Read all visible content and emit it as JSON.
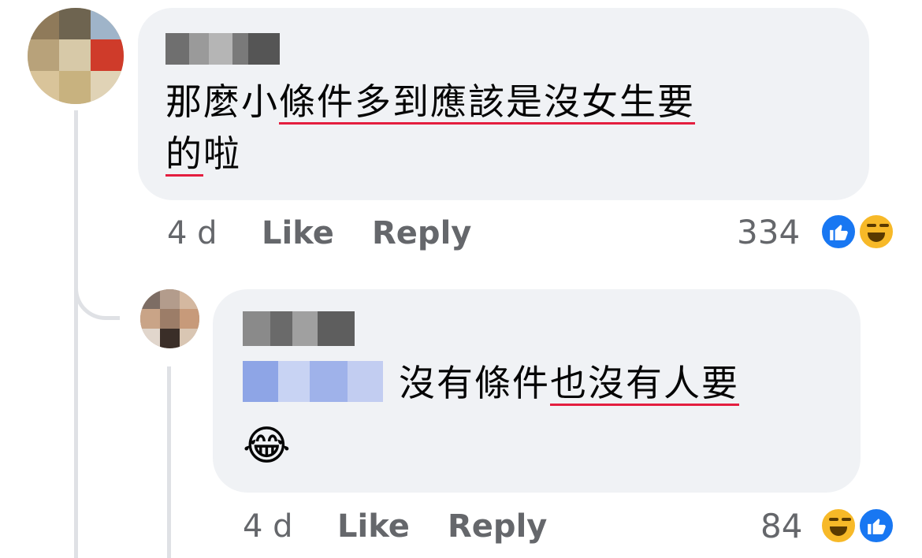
{
  "colors": {
    "bubble": "#f0f2f5",
    "meta_text": "#65676b",
    "spell_underline": "#e41e3f",
    "like_blue": "#1877f2",
    "haha_yellow": "#f7b928"
  },
  "comments": [
    {
      "author": "",
      "text_plain": "那麼小",
      "text_underlined": "條件多到應該是沒女生要",
      "text_line2_underlined": "的",
      "text_line2_plain": "啦",
      "time": "4 d",
      "like_label": "Like",
      "reply_label": "Reply",
      "reaction_count": "334",
      "reactions": [
        "like-icon",
        "haha-icon"
      ]
    },
    {
      "author": "",
      "mention": "",
      "text_plain": "沒有條件",
      "text_underlined": "也沒有人要",
      "emoji": "😂",
      "time": "4 d",
      "like_label": "Like",
      "reply_label": "Reply",
      "reaction_count": "84",
      "reactions": [
        "haha-icon",
        "like-icon"
      ]
    }
  ]
}
